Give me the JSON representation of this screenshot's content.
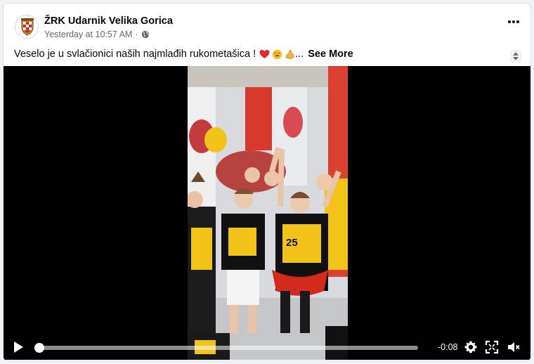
{
  "post": {
    "page_name": "ŽRK Udarnik Velika Gorica",
    "timestamp": "Yesterday at 10:57 AM",
    "separator": "·",
    "audience_icon": "globe-icon",
    "menu_icon": "more-options-icon",
    "caption_text": "Veselo je u svlačionici naših najmlađih rukometašica !",
    "caption_emojis": [
      "red-heart-emoji",
      "grinning-face-emoji",
      "flexed-biceps-emoji"
    ],
    "ellipsis": "...",
    "see_more_label": "See More"
  },
  "video": {
    "time_remaining": "-0:08",
    "progress": 0.01,
    "controls": [
      "play-icon",
      "settings-gear-icon",
      "fullscreen-icon",
      "muted-speaker-icon"
    ]
  },
  "colors": {
    "page_bg": "#f0f2f5",
    "card_bg": "#ffffff",
    "text_primary": "#050505",
    "text_secondary": "#65676b",
    "video_bg": "#000000",
    "jersey_yellow": "#f2c318",
    "club_red": "#d42a1e"
  }
}
